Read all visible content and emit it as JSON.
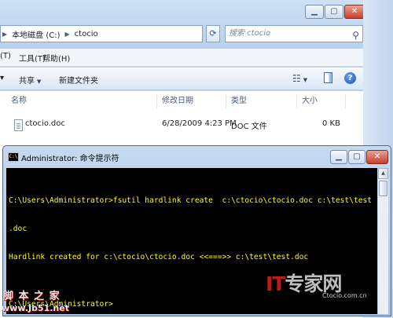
{
  "explorer": {
    "address": {
      "segments": [
        "本地磁盘 (C:)",
        "ctocio"
      ]
    },
    "search": {
      "placeholder": "搜索 ctocio"
    },
    "menu": [
      {
        "label": "(T)"
      },
      {
        "label": "工具(T)"
      },
      {
        "label": "帮助(H)"
      }
    ],
    "toolbar": {
      "share_label": "共享",
      "new_folder_label": "新建文件夹"
    },
    "columns": {
      "name": "名称",
      "modified": "修改日期",
      "type": "类型",
      "size": "大小"
    },
    "files": [
      {
        "name": "ctocio.doc",
        "modified": "6/28/2009 4:23 PM",
        "type": "DOC 文件",
        "size": "0 KB"
      }
    ]
  },
  "cmd": {
    "title": "Administrator: 命令提示符",
    "lines": [
      {
        "text": "C:\\Users\\Administrator>fsutil hardlink create  c:\\ctocio\\ctocio.doc c:\\test\\test",
        "highlight": true
      },
      {
        "text": ".doc",
        "highlight": true
      },
      {
        "text": "Hardlink created for c:\\ctocio\\ctocio.doc <<===>> c:\\test\\test.doc",
        "highlight": true
      },
      {
        "text": "",
        "highlight": false
      },
      {
        "text": "C:\\Users\\Administrator>",
        "highlight": true
      }
    ]
  },
  "watermark": {
    "left_line1": "脚 本 之 家",
    "left_line2": "www.Jb51.net",
    "right_brand_accent": "IT",
    "right_brand_rest": "专家网",
    "right_site": "Ctocio.com.cn"
  },
  "colors": {
    "console_bg": "#000000",
    "console_text": "#ffff00",
    "close_button": "#c3412d"
  }
}
